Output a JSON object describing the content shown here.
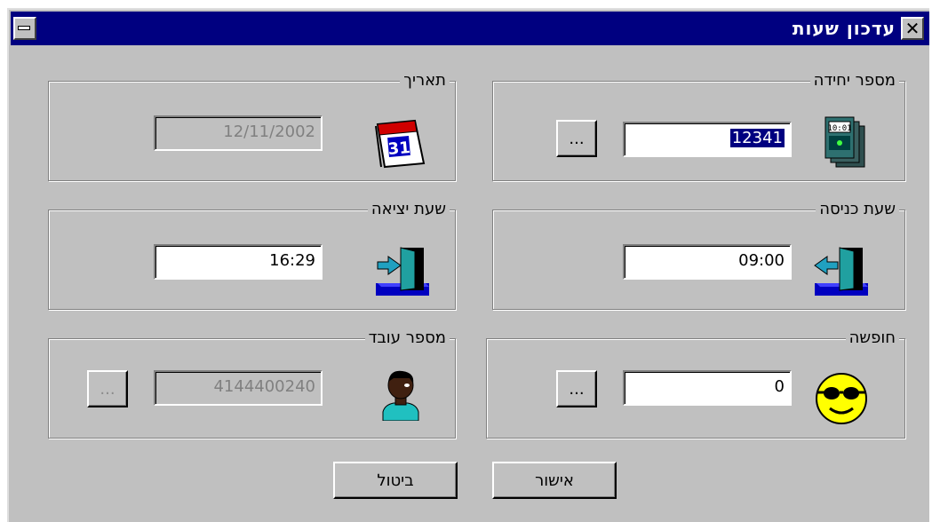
{
  "window": {
    "title": "עדכון שעות"
  },
  "unit": {
    "label": "מספר יחידה",
    "value": "12341",
    "browse": "..."
  },
  "date": {
    "label": "תאריך",
    "value": "12/11/2002"
  },
  "entry_time": {
    "label": "שעת כניסה",
    "value": "09:00"
  },
  "exit_time": {
    "label": "שעת יציאה",
    "value": "16:29"
  },
  "vacation": {
    "label": "חופשה",
    "value": "0",
    "browse": "..."
  },
  "employee": {
    "label": "מספר עובד",
    "value": "4144400240",
    "browse": "..."
  },
  "buttons": {
    "ok": "אישור",
    "cancel": "ביטול"
  },
  "icons": {
    "unit": "time-clock-device-icon",
    "date": "calendar-icon",
    "entry": "door-enter-icon",
    "exit": "door-exit-icon",
    "vacation": "sunglasses-smiley-icon",
    "employee": "person-icon"
  }
}
